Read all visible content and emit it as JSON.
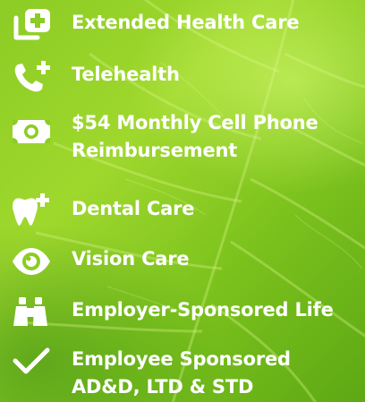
{
  "benefits": [
    {
      "label": "Extended Health Care",
      "icon": "medical-folder-plus-icon"
    },
    {
      "label": "Telehealth",
      "icon": "phone-plus-icon"
    },
    {
      "label": "$54 Monthly Cell Phone Reimbursement",
      "icon": "money-bill-icon"
    },
    {
      "label": "Dental Care",
      "icon": "tooth-plus-icon"
    },
    {
      "label": "Vision Care",
      "icon": "eye-icon"
    },
    {
      "label": "Employer-Sponsored Life",
      "icon": "binoculars-icon"
    },
    {
      "label": "Employee Sponsored AD&D, LTD & STD",
      "icon": "checkmark-icon"
    }
  ],
  "colors": {
    "text": "#ffffff",
    "background": "#8ccc24"
  }
}
